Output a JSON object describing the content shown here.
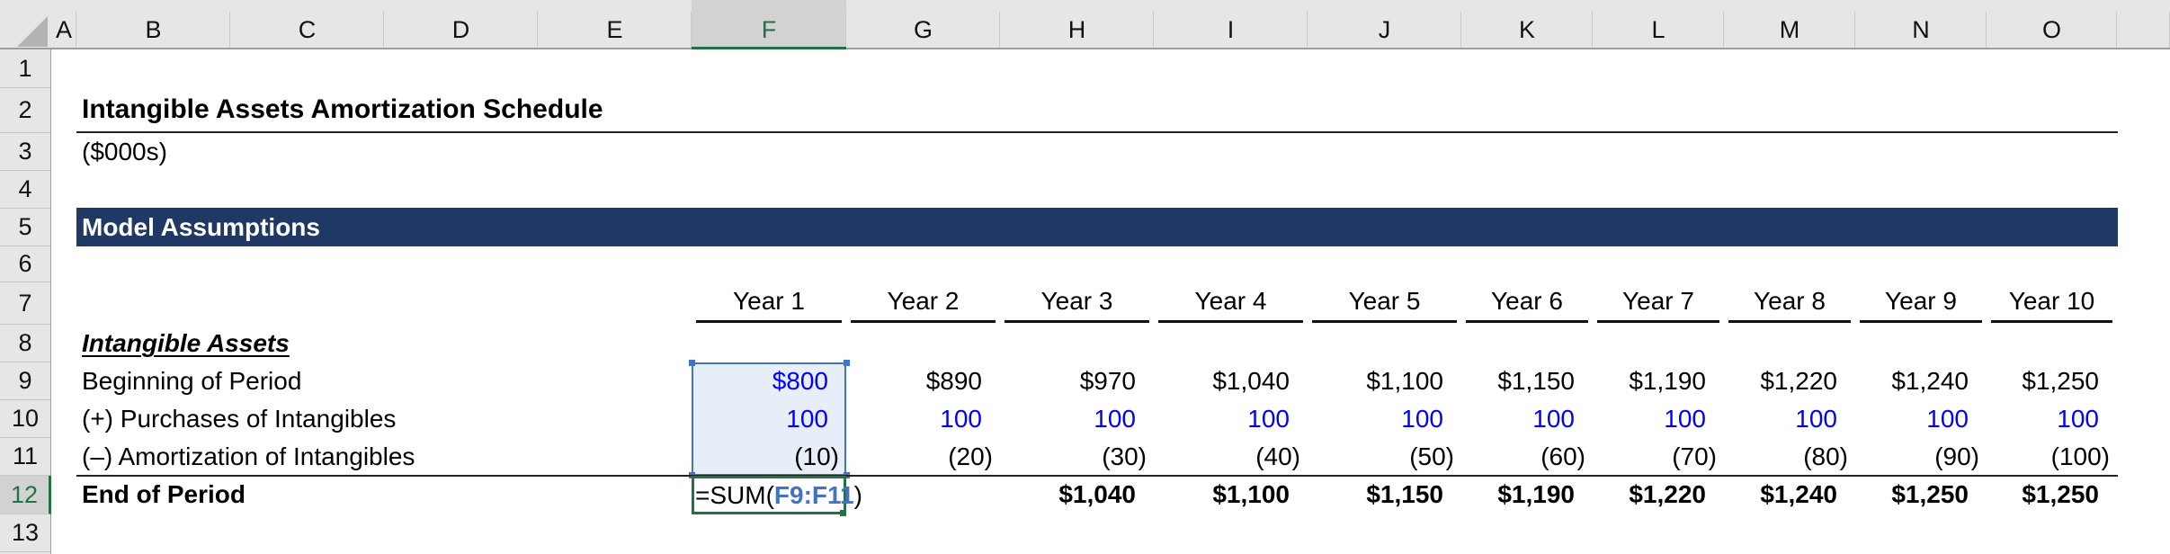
{
  "sheet": {
    "corner_icon": "select-all-icon",
    "columns": [
      "A",
      "B",
      "C",
      "D",
      "E",
      "F",
      "G",
      "H",
      "I",
      "J",
      "K",
      "L",
      "M",
      "N",
      "O",
      ""
    ],
    "selected_column": "F",
    "rows": [
      "1",
      "2",
      "3",
      "4",
      "5",
      "6",
      "7",
      "8",
      "9",
      "10",
      "11",
      "12",
      "13"
    ],
    "selected_row": "12"
  },
  "title": "Intangible Assets Amortization Schedule",
  "units": "($000s)",
  "section_header": "Model Assumptions",
  "years": [
    "Year 1",
    "Year 2",
    "Year 3",
    "Year 4",
    "Year 5",
    "Year 6",
    "Year 7",
    "Year 8",
    "Year 9",
    "Year 10"
  ],
  "table": {
    "section_label": "Intangible Assets",
    "rows": [
      {
        "label": "Beginning of Period",
        "values": [
          "$800",
          "$890",
          "$970",
          "$1,040",
          "$1,100",
          "$1,150",
          "$1,190",
          "$1,220",
          "$1,240",
          "$1,250"
        ]
      },
      {
        "label": "(+) Purchases of Intangibles",
        "values": [
          "100",
          "100",
          "100",
          "100",
          "100",
          "100",
          "100",
          "100",
          "100",
          "100"
        ]
      },
      {
        "label": "(–) Amortization of Intangibles",
        "values": [
          "(10)",
          "(20)",
          "(30)",
          "(40)",
          "(50)",
          "(60)",
          "(70)",
          "(80)",
          "(90)",
          "(100)"
        ]
      },
      {
        "label": "End of Period",
        "values": [
          "",
          "",
          "$1,040",
          "$1,100",
          "$1,150",
          "$1,190",
          "$1,220",
          "$1,240",
          "$1,250",
          "$1,250"
        ]
      }
    ]
  },
  "editing": {
    "cell": "F12",
    "formula_prefix": "=SUM(",
    "formula_ref": "F9:F11",
    "formula_suffix": ")"
  },
  "colors": {
    "banner": "#203864",
    "input_blue": "#0000ff",
    "selection_fill": "#e8eef8",
    "selection_border": "#4472c4",
    "active_cell_border": "#217346"
  }
}
